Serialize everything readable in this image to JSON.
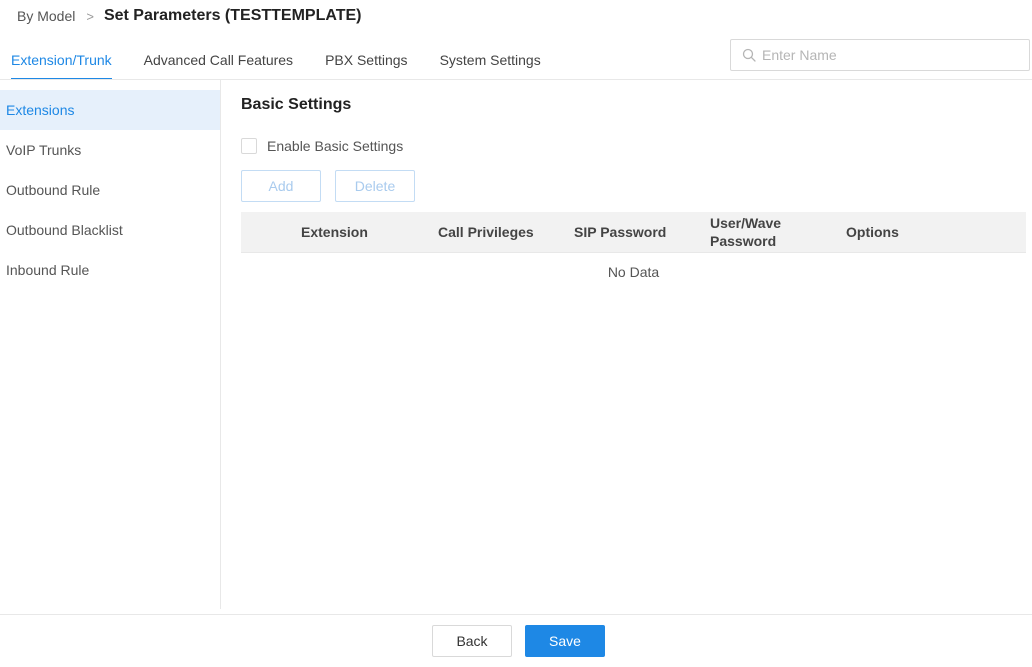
{
  "breadcrumb": {
    "parent": "By Model",
    "separator": ">",
    "current": "Set Parameters (TESTTEMPLATE)"
  },
  "tabs": [
    {
      "label": "Extension/Trunk",
      "active": true
    },
    {
      "label": "Advanced Call Features",
      "active": false
    },
    {
      "label": "PBX Settings",
      "active": false
    },
    {
      "label": "System Settings",
      "active": false
    }
  ],
  "search": {
    "placeholder": "Enter Name",
    "value": "",
    "icon": "search-icon"
  },
  "sidebar": {
    "items": [
      {
        "label": "Extensions",
        "active": true
      },
      {
        "label": "VoIP Trunks",
        "active": false
      },
      {
        "label": "Outbound Rule",
        "active": false
      },
      {
        "label": "Outbound Blacklist",
        "active": false
      },
      {
        "label": "Inbound Rule",
        "active": false
      }
    ]
  },
  "main": {
    "section_title": "Basic Settings",
    "enable_label": "Enable Basic Settings",
    "enable_checked": false,
    "add_label": "Add",
    "delete_label": "Delete",
    "table": {
      "columns": [
        "Extension",
        "Call Privileges",
        "SIP Password",
        "User/Wave Password",
        "Options"
      ],
      "rows": [],
      "empty_text": "No Data"
    }
  },
  "footer": {
    "back_label": "Back",
    "save_label": "Save"
  },
  "colors": {
    "accent": "#1e88e5",
    "active_bg": "#e6f0fb",
    "disabled_button_text": "#a9cbee"
  }
}
